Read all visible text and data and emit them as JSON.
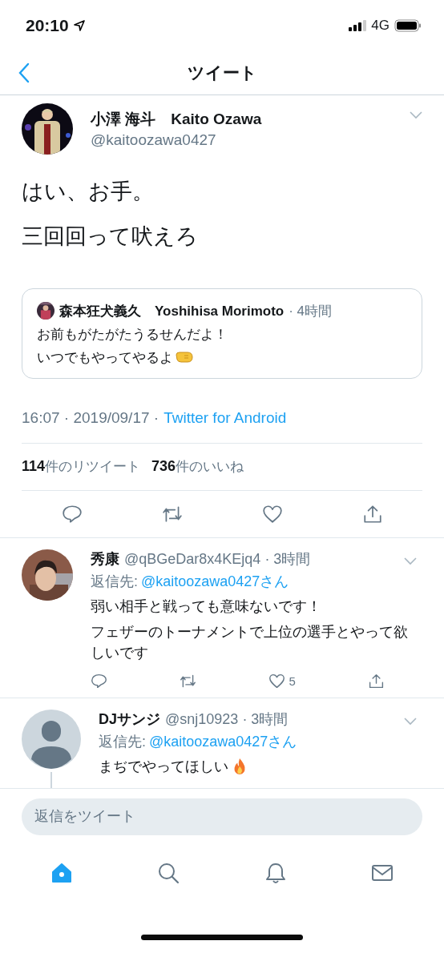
{
  "status_bar": {
    "time": "20:10",
    "network": "4G"
  },
  "nav": {
    "title": "ツイート"
  },
  "tweet": {
    "name": "小澤 海斗　Kaito Ozawa",
    "handle": "@kaitoozawa0427",
    "lines": [
      "はい、お手。",
      "三回回って吠えろ"
    ],
    "quote": {
      "name": "森本狂犬義久　Yoshihisa Morimoto",
      "time": "· 4時間",
      "lines": [
        {
          "text": "お前もがたがたうるせんだよ！"
        },
        {
          "text": "いつでもやってやるよ",
          "kind": "fist"
        }
      ]
    },
    "timestamp": "16:07 · 2019/09/17 ·",
    "source": "Twitter for Android",
    "retweet_count": "114",
    "retweet_label": "件のリツイート",
    "like_count": "736",
    "like_label": "件のいいね"
  },
  "replies": [
    {
      "name": "秀康",
      "handle": "@qBGeDar8x4KEjq4",
      "time": "· 3時間",
      "reply_label": "返信先:",
      "reply_to": "@kaitoozawa0427さん",
      "thread": false,
      "lines": [
        {
          "text": "弱い相手と戦っても意味ないです！",
          "kind": "plain"
        },
        {
          "text": "フェザーのトーナメントで上位の選手とやって欲しいです",
          "kind": "plain"
        }
      ],
      "like_count": "5",
      "actions": true
    },
    {
      "name": "DJサンジ",
      "handle": "@snj10923",
      "time": "· 3時間",
      "reply_label": "返信先:",
      "reply_to": "@kaitoozawa0427さん",
      "kind": "default",
      "thread": true,
      "lines": [
        {
          "text": "まぢでやってほしい",
          "kind": "fire"
        }
      ],
      "actions": false
    }
  ],
  "compose": {
    "placeholder": "返信をツイート"
  },
  "tabs": [
    {
      "selected": true
    },
    {
      "selected": false
    },
    {
      "selected": false
    },
    {
      "selected": false
    }
  ]
}
